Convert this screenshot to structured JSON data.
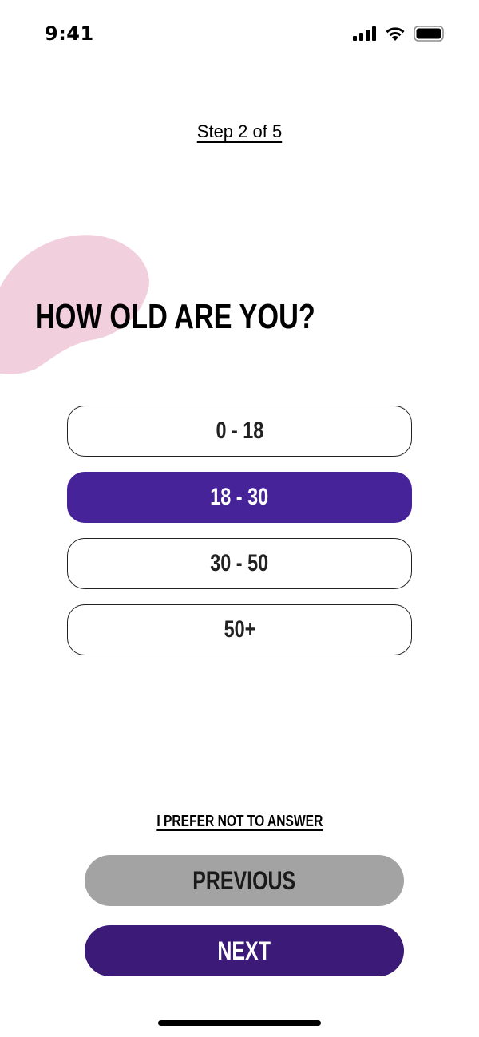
{
  "status_bar": {
    "time": "9:41",
    "icons": [
      "cellular-signal-icon",
      "wifi-icon",
      "battery-icon"
    ]
  },
  "step": {
    "label": "Step 2 of 5"
  },
  "question": {
    "title": "HOW OLD ARE YOU?"
  },
  "options": [
    {
      "label": "0 - 18",
      "selected": false
    },
    {
      "label": "18 - 30",
      "selected": true
    },
    {
      "label": "30 - 50",
      "selected": false
    },
    {
      "label": "50+",
      "selected": false
    }
  ],
  "skip": {
    "label": "I PREFER NOT TO ANSWER"
  },
  "buttons": {
    "previous_label": "PREVIOUS",
    "next_label": "NEXT"
  },
  "colors": {
    "accent": "#47239a",
    "next_button": "#3b1a78",
    "previous_button": "#a3a3a3",
    "blob": "#f2cfdc",
    "background": "#ffffff"
  }
}
